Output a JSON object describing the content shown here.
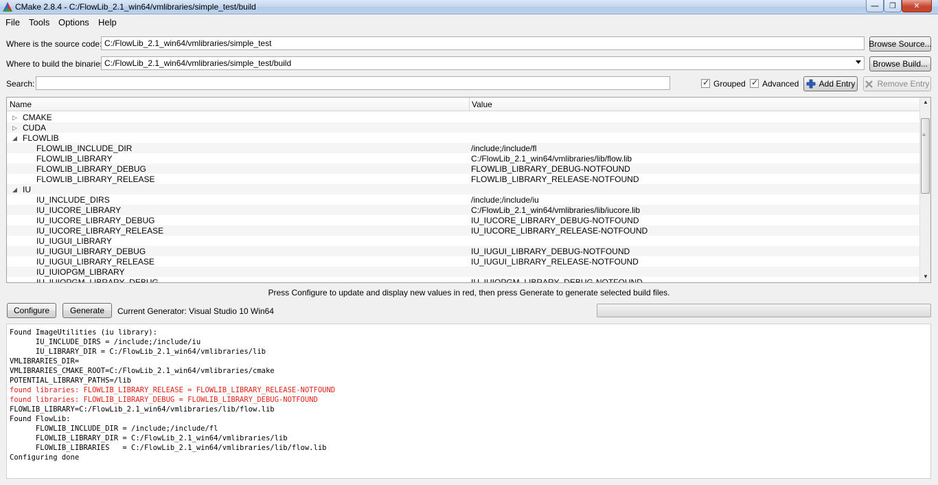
{
  "window": {
    "title": "CMake 2.8.4 - C:/FlowLib_2.1_win64/vmlibraries/simple_test/build",
    "min_glyph": "—",
    "max_glyph": "❐",
    "close_glyph": "✕"
  },
  "menu": [
    {
      "label": "File"
    },
    {
      "label": "Tools"
    },
    {
      "label": "Options"
    },
    {
      "label": "Help"
    }
  ],
  "source": {
    "label": "Where is the source code:",
    "value": "C:/FlowLib_2.1_win64/vmlibraries/simple_test",
    "browse_label": "Browse Source..."
  },
  "build": {
    "label": "Where to build the binaries:",
    "value": "C:/FlowLib_2.1_win64/vmlibraries/simple_test/build",
    "browse_label": "Browse Build..."
  },
  "search": {
    "label": "Search:",
    "value": ""
  },
  "options": {
    "grouped_label": "Grouped",
    "grouped_checked": true,
    "advanced_label": "Advanced",
    "advanced_checked": true,
    "add_entry_label": "Add Entry",
    "remove_entry_label": "Remove Entry"
  },
  "table": {
    "columns": {
      "name": "Name",
      "value": "Value"
    },
    "rows": [
      {
        "name": "CMAKE",
        "value": "",
        "group": true,
        "expanded": false
      },
      {
        "name": "CUDA",
        "value": "",
        "group": true,
        "expanded": false
      },
      {
        "name": "FLOWLIB",
        "value": "",
        "group": true,
        "expanded": true
      },
      {
        "name": "FLOWLIB_INCLUDE_DIR",
        "value": "/include;/include/fl"
      },
      {
        "name": "FLOWLIB_LIBRARY",
        "value": "C:/FlowLib_2.1_win64/vmlibraries/lib/flow.lib"
      },
      {
        "name": "FLOWLIB_LIBRARY_DEBUG",
        "value": "FLOWLIB_LIBRARY_DEBUG-NOTFOUND"
      },
      {
        "name": "FLOWLIB_LIBRARY_RELEASE",
        "value": "FLOWLIB_LIBRARY_RELEASE-NOTFOUND"
      },
      {
        "name": "IU",
        "value": "",
        "group": true,
        "expanded": true
      },
      {
        "name": "IU_INCLUDE_DIRS",
        "value": "/include;/include/iu"
      },
      {
        "name": "IU_IUCORE_LIBRARY",
        "value": "C:/FlowLib_2.1_win64/vmlibraries/lib/iucore.lib"
      },
      {
        "name": "IU_IUCORE_LIBRARY_DEBUG",
        "value": "IU_IUCORE_LIBRARY_DEBUG-NOTFOUND"
      },
      {
        "name": "IU_IUCORE_LIBRARY_RELEASE",
        "value": "IU_IUCORE_LIBRARY_RELEASE-NOTFOUND"
      },
      {
        "name": "IU_IUGUI_LIBRARY",
        "value": ""
      },
      {
        "name": "IU_IUGUI_LIBRARY_DEBUG",
        "value": "IU_IUGUI_LIBRARY_DEBUG-NOTFOUND"
      },
      {
        "name": "IU_IUGUI_LIBRARY_RELEASE",
        "value": "IU_IUGUI_LIBRARY_RELEASE-NOTFOUND"
      },
      {
        "name": "IU_IUIOPGM_LIBRARY",
        "value": ""
      },
      {
        "name": "IU_IUIOPGM_LIBRARY_DEBUG",
        "value": "IU_IUIOPGM_LIBRARY_DEBUG-NOTFOUND"
      }
    ]
  },
  "hint": "Press Configure to update and display new values in red, then press Generate to generate selected build files.",
  "actions": {
    "configure_label": "Configure",
    "generate_label": "Generate",
    "generator_text": "Current Generator: Visual Studio 10 Win64",
    "progress": 0
  },
  "output": {
    "lines": [
      {
        "text": "Found ImageUtilities (iu library):",
        "error": false
      },
      {
        "text": "      IU_INCLUDE_DIRS = /include;/include/iu",
        "error": false
      },
      {
        "text": "      IU_LIBRARY_DIR = C:/FlowLib_2.1_win64/vmlibraries/lib",
        "error": false
      },
      {
        "text": "VMLIBRARIES_DIR=",
        "error": false
      },
      {
        "text": "VMLIBRARIES_CMAKE_ROOT=C:/FlowLib_2.1_win64/vmlibraries/cmake",
        "error": false
      },
      {
        "text": "POTENTIAL_LIBRARY_PATHS=/lib",
        "error": false
      },
      {
        "text": "found libraries: FLOWLIB_LIBRARY_RELEASE = FLOWLIB_LIBRARY_RELEASE-NOTFOUND",
        "error": true
      },
      {
        "text": "found libraries: FLOWLIB_LIBRARY_DEBUG = FLOWLIB_LIBRARY_DEBUG-NOTFOUND",
        "error": true
      },
      {
        "text": "FLOWLIB_LIBRARY=C:/FlowLib_2.1_win64/vmlibraries/lib/flow.lib",
        "error": false
      },
      {
        "text": "Found FlowLib:",
        "error": false
      },
      {
        "text": "      FLOWLIB_INCLUDE_DIR = /include;/include/fl",
        "error": false
      },
      {
        "text": "      FLOWLIB_LIBRARY_DIR = C:/FlowLib_2.1_win64/vmlibraries/lib",
        "error": false
      },
      {
        "text": "      FLOWLIB_LIBRARIES   = C:/FlowLib_2.1_win64/vmlibraries/lib/flow.lib",
        "error": false
      },
      {
        "text": "Configuring done",
        "error": false
      }
    ]
  },
  "colors": {
    "error_text": "#e0201a",
    "alt_row": "#f5f5f5"
  }
}
